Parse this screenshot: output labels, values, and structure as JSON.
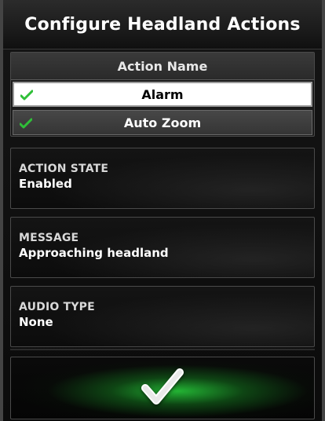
{
  "screen": {
    "title": "Configure Headland Actions"
  },
  "actions_list": {
    "header": "Action Name",
    "items": [
      {
        "label": "Alarm",
        "selected": true,
        "enabled_icon": "check-icon"
      },
      {
        "label": "Auto Zoom",
        "selected": false,
        "enabled_icon": "check-icon"
      }
    ]
  },
  "settings": [
    {
      "label": "ACTION STATE",
      "value": "Enabled"
    },
    {
      "label": "MESSAGE",
      "value": "Approaching headland"
    },
    {
      "label": "AUDIO TYPE",
      "value": "None"
    }
  ],
  "confirm": {
    "icon": "checkmark-icon",
    "accent": "#2ad23c"
  }
}
